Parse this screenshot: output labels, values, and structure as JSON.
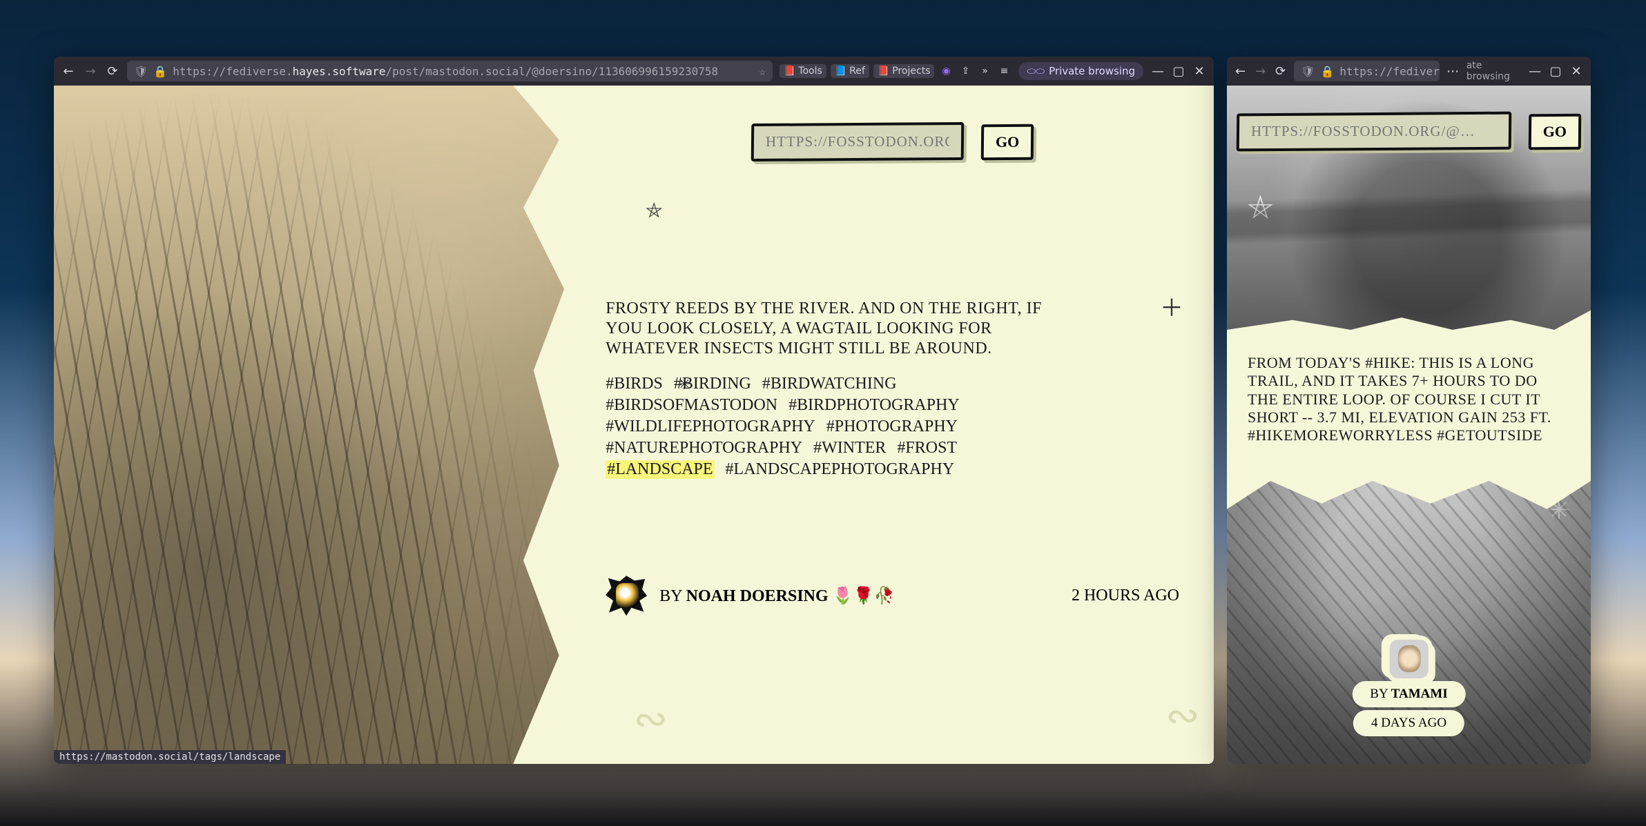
{
  "browser": {
    "url_left_dim_a": "https://fediverse.",
    "url_left_bright": "hayes.software",
    "url_left_dim_b": "/post/mastodon.social/@doersino/113606996159230758",
    "url_right": "https://fediverse",
    "private_label": "Private browsing",
    "right_trail": "ate browsing",
    "bookmarks": {
      "tools": "Tools",
      "ref": "Ref",
      "projects": "Projects"
    },
    "status_bar": "https://mastodon.social/tags/landscape"
  },
  "search": {
    "placeholder": "https://fosstodon.org/@…",
    "go_label": "Go"
  },
  "postA": {
    "body": "Frosty reeds by the river. And on the right, if you look closely, a wagtail looking for whatever insects might still be around.",
    "tags": [
      "#birds",
      "#birding",
      "#birdwatching",
      "#birdsofmastodon",
      "#birdphotography",
      "#wildlifephotography",
      "#photography",
      "#naturephotography",
      "#winter",
      "#frost",
      "#landscape",
      "#landscapephotography"
    ],
    "highlight": "#landscape",
    "by_prefix": "by",
    "author": "Noah Doersing",
    "author_emoji": "🌷🌹🥀",
    "ago": "2 hours ago"
  },
  "postB": {
    "body": "From today's #hike: This is a long trail, and it takes 7+ hours to do the entire loop. Of course I cut it short -- 3.7 mi, elevation gain 253 ft. #hikemoreworryless #getoutside",
    "by_prefix": "by",
    "author": "Tamami",
    "ago": "4 days ago"
  }
}
